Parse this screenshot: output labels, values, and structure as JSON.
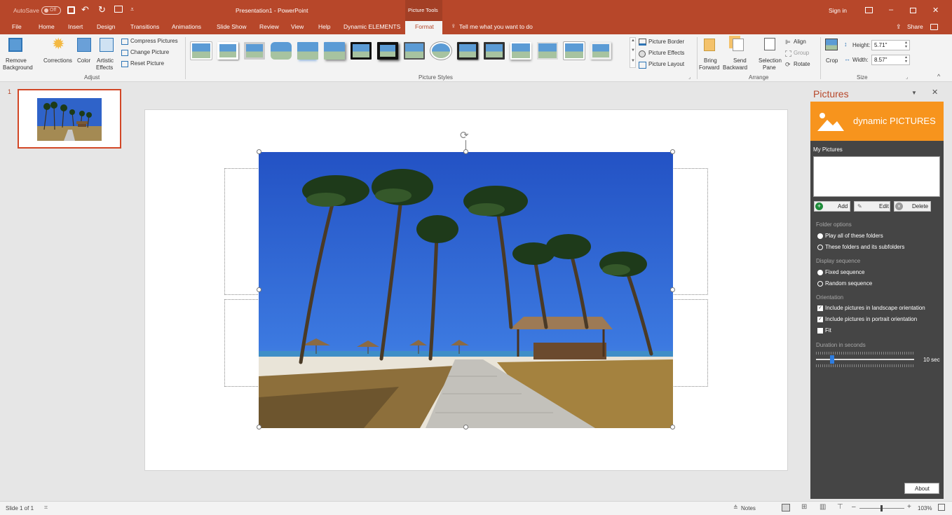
{
  "titlebar": {
    "autosave_label": "AutoSave",
    "autosave_state": "Off",
    "doc_title": "Presentation1  -  PowerPoint",
    "context_tools": "Picture Tools",
    "sign_in": "Sign in"
  },
  "tabs": {
    "items": [
      "File",
      "Home",
      "Insert",
      "Design",
      "Transitions",
      "Animations",
      "Slide Show",
      "Review",
      "View",
      "Help",
      "Dynamic ELEMENTS",
      "Format"
    ],
    "active": "Format",
    "tell_me": "Tell me what you want to do",
    "share": "Share"
  },
  "ribbon": {
    "adjust": {
      "remove_background": [
        "Remove",
        "Background"
      ],
      "corrections": "Corrections",
      "color": "Color",
      "artistic_effects": [
        "Artistic",
        "Effects"
      ],
      "compress": "Compress Pictures",
      "change": "Change Picture",
      "reset": "Reset Picture",
      "group_label": "Adjust"
    },
    "picture_styles": {
      "border": "Picture Border",
      "effects": "Picture Effects",
      "layout": "Picture Layout",
      "group_label": "Picture Styles"
    },
    "arrange": {
      "bring_forward": [
        "Bring",
        "Forward"
      ],
      "send_backward": [
        "Send",
        "Backward"
      ],
      "selection_pane": [
        "Selection",
        "Pane"
      ],
      "align": "Align",
      "group": "Group",
      "rotate": "Rotate",
      "group_label": "Arrange"
    },
    "size": {
      "crop": "Crop",
      "height_label": "Height:",
      "height_value": "5.71\"",
      "width_label": "Width:",
      "width_value": "8.57\"",
      "group_label": "Size"
    }
  },
  "thumbnails": {
    "slide_number": "1"
  },
  "pane": {
    "title": "Pictures",
    "brand": "dynamic PICTURES",
    "my_pictures": "My Pictures",
    "add": "Add",
    "edit": "Edit",
    "delete": "Delete",
    "folder_options": "Folder options",
    "folder_opt1": "Play all of these folders",
    "folder_opt2": "These folders and its subfolders",
    "display_sequence": "Display sequence",
    "seq_opt1": "Fixed sequence",
    "seq_opt2": "Random sequence",
    "orientation": "Orientation",
    "orient_opt1": "Include pictures in landscape orientation",
    "orient_opt2": "Include pictures in portrait orientation",
    "orient_opt3": "Fit",
    "duration_label": "Duration in seconds",
    "duration_value": "10 sec",
    "duration_fraction": 0.15,
    "about": "About"
  },
  "status": {
    "slide_info": "Slide 1 of 1",
    "notes": "Notes",
    "zoom": "103%"
  },
  "colors": {
    "accent": "#b7472a",
    "pane_bg": "#454545",
    "brand": "#f7941d"
  }
}
